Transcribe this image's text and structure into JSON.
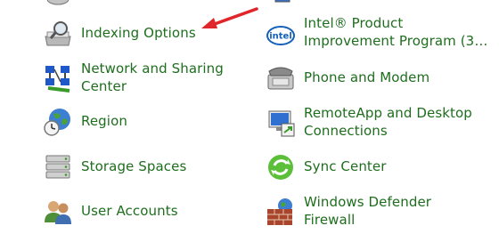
{
  "left_column": {
    "items": [
      {
        "label": "Indexing Options",
        "icon": "indexing-options-icon"
      },
      {
        "label_lines": [
          "Network and Sharing",
          "Center"
        ],
        "icon": "network-sharing-icon"
      },
      {
        "label": "Region",
        "icon": "region-globe-icon"
      },
      {
        "label": "Storage Spaces",
        "icon": "storage-spaces-icon"
      },
      {
        "label": "User Accounts",
        "icon": "user-accounts-icon"
      }
    ]
  },
  "right_column": {
    "items": [
      {
        "label_lines": [
          "Intel® Product",
          "Improvement Program (3…"
        ],
        "icon": "intel-icon",
        "icon_text": "intel"
      },
      {
        "label": "Phone and Modem",
        "icon": "phone-modem-icon"
      },
      {
        "label_lines": [
          "RemoteApp and Desktop",
          "Connections"
        ],
        "icon": "remoteapp-icon"
      },
      {
        "label": "Sync Center",
        "icon": "sync-center-icon"
      },
      {
        "label_lines": [
          "Windows Defender",
          "Firewall"
        ],
        "icon": "firewall-icon"
      }
    ]
  },
  "colors": {
    "link": "#1e6e1e",
    "arrow": "#e0262a"
  }
}
